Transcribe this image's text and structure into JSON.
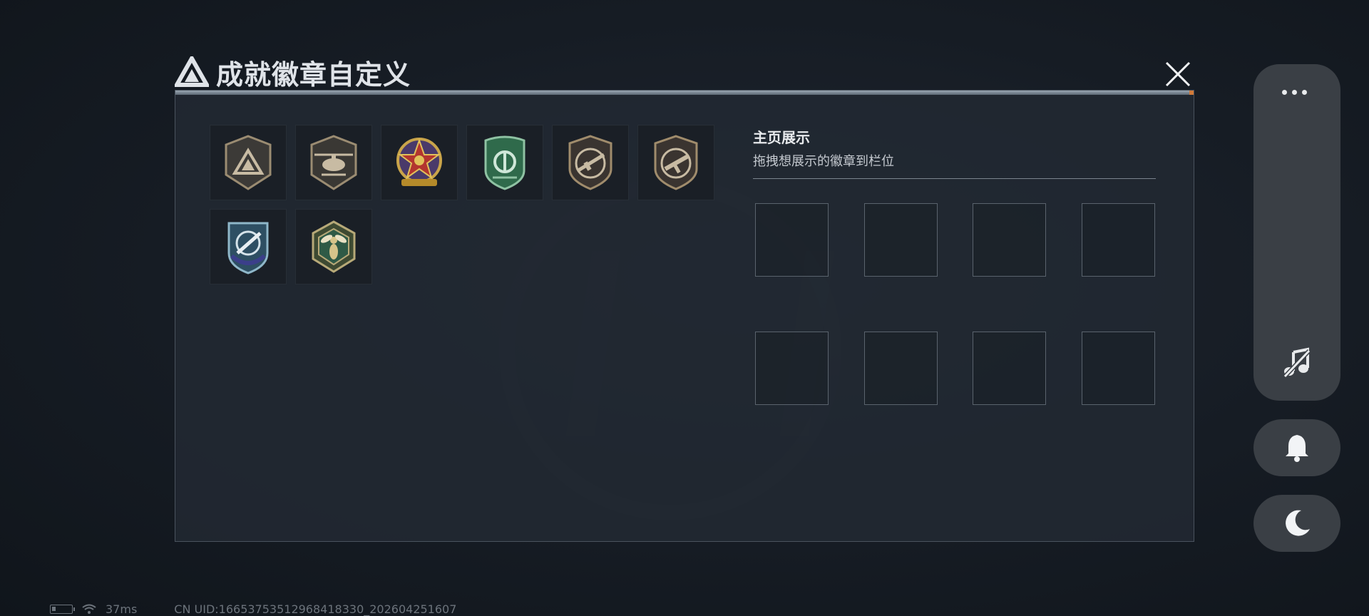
{
  "dialog": {
    "title": "成就徽章自定义",
    "icon": "triangle-logo-icon",
    "close_icon": "close-icon"
  },
  "badges": [
    {
      "name": "triangle-emblem-badge",
      "color": "#8a7a63"
    },
    {
      "name": "helicopter-badge",
      "color": "#8a7a63"
    },
    {
      "name": "star-medal-badge",
      "color": "#b3352f"
    },
    {
      "name": "green-shield-badge",
      "color": "#3f7a5a"
    },
    {
      "name": "rifle-badge",
      "color": "#8a7a63"
    },
    {
      "name": "smg-badge",
      "color": "#8a7a63"
    },
    {
      "name": "knife-crosshair-badge",
      "color": "#2e5f7a"
    },
    {
      "name": "wasp-hexagon-badge",
      "color": "#6f7a4a"
    }
  ],
  "showcase": {
    "title": "主页展示",
    "subtitle": "拖拽想展示的徽章到栏位",
    "slot_count": 8
  },
  "rail": {
    "more_icon": "more-dots-icon",
    "music_icon": "music-off-icon",
    "bell_icon": "bell-icon",
    "moon_icon": "moon-icon"
  },
  "status_bar": {
    "ping": "37ms",
    "uid": "CN UID:16653753512968418330_202604251607"
  }
}
